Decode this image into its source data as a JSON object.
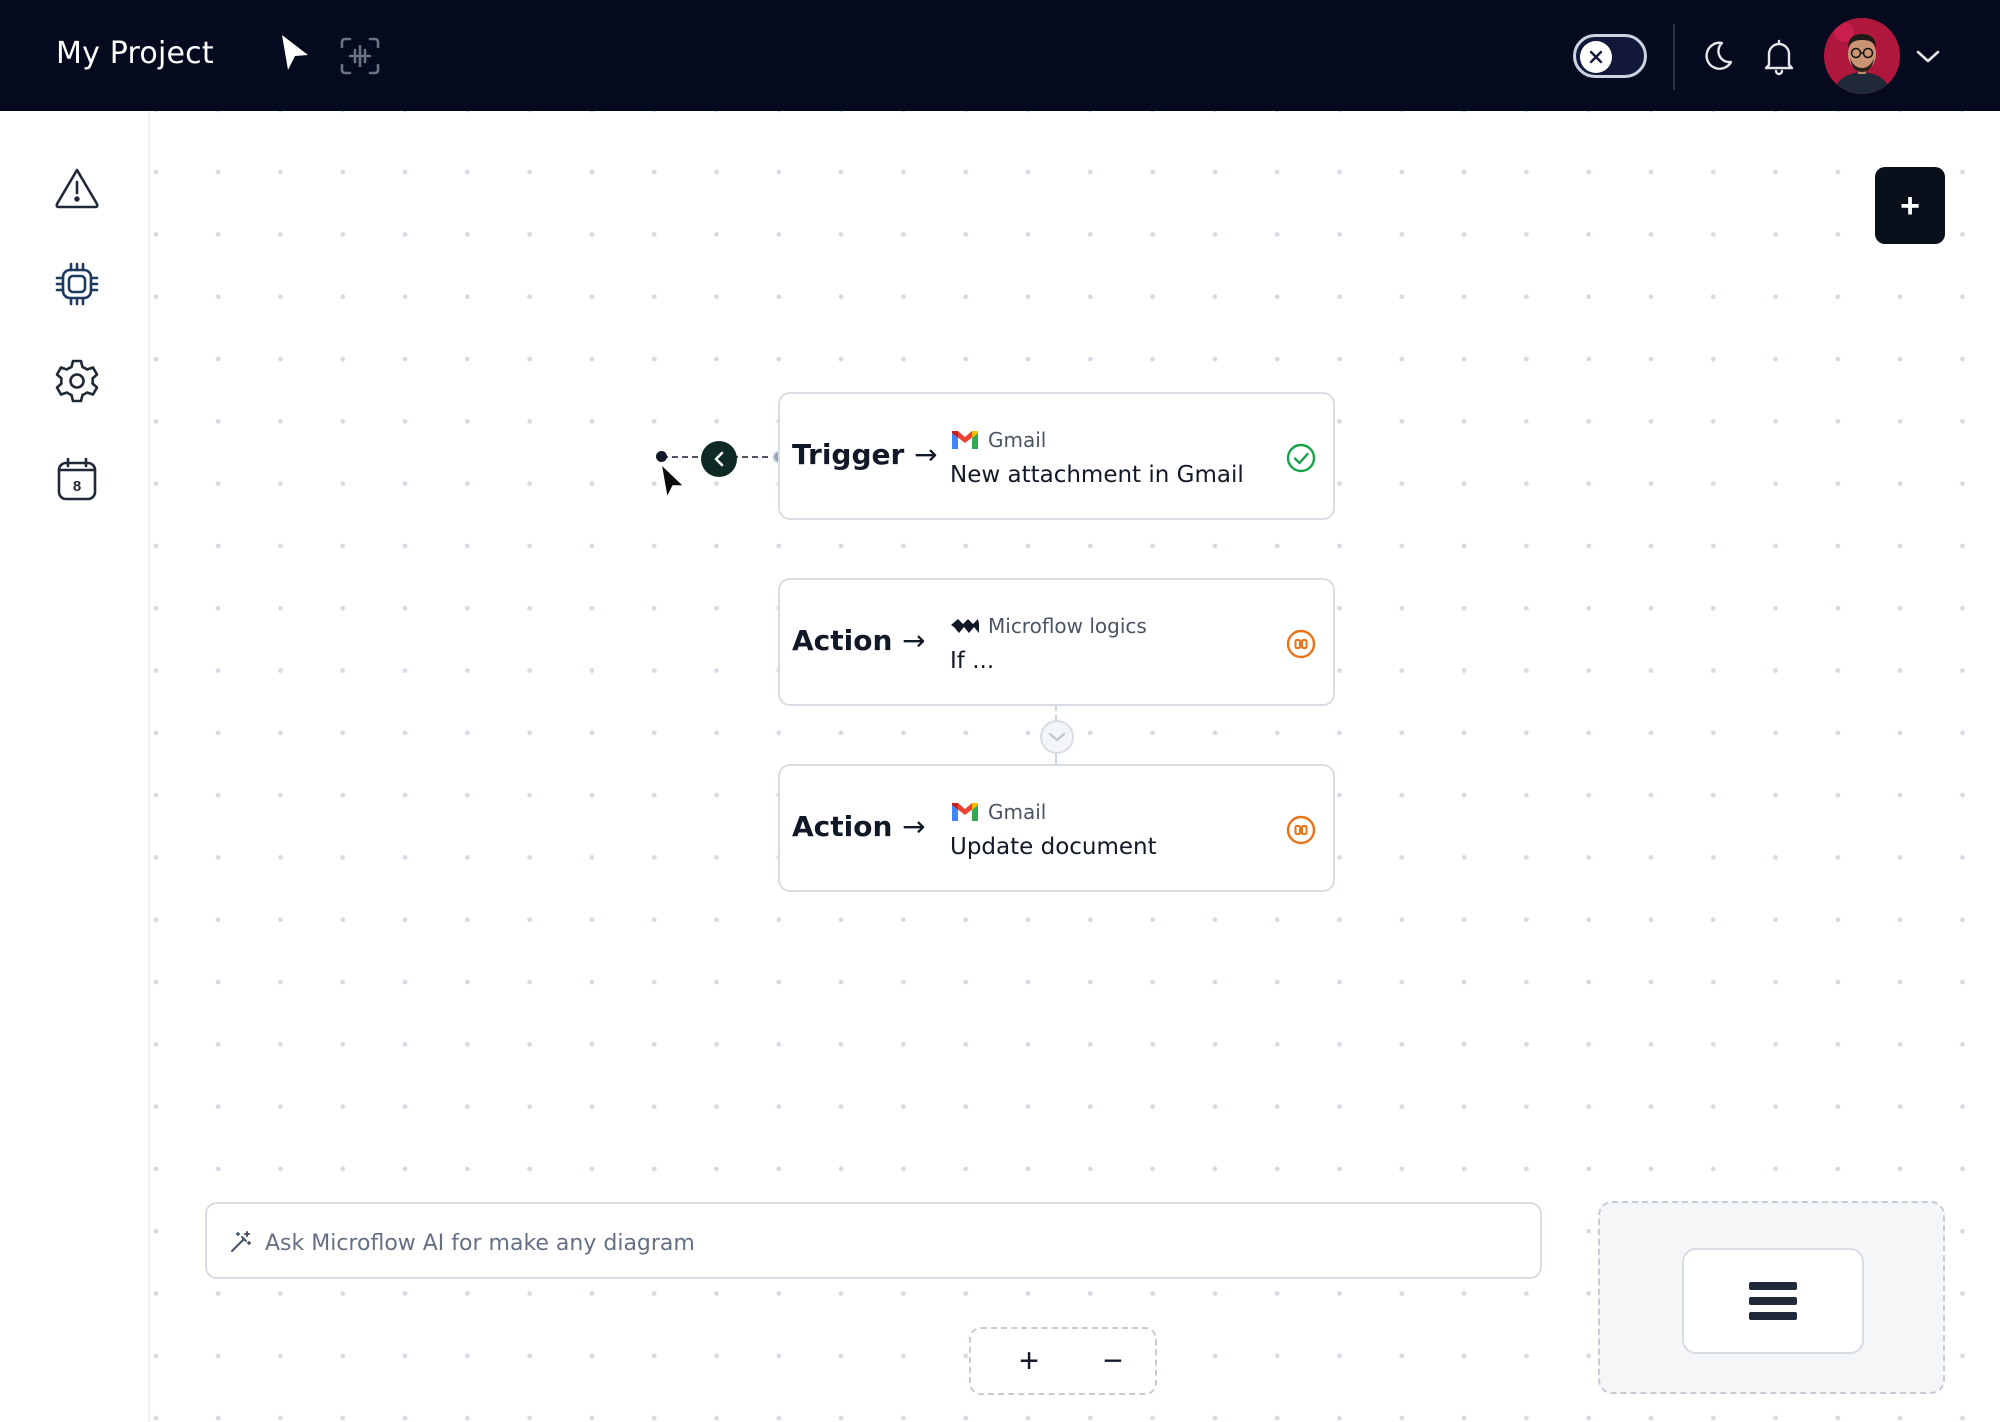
{
  "header": {
    "project_title": "My Project",
    "tools": [
      "pointer-tool",
      "frame-tool"
    ],
    "toggle_state": "off",
    "icons": [
      "moon-icon",
      "bell-icon",
      "chevron-down-icon"
    ]
  },
  "sidebar": {
    "items": [
      {
        "icon": "warning-icon"
      },
      {
        "icon": "chip-icon"
      },
      {
        "icon": "gear-icon"
      },
      {
        "icon": "calendar-icon",
        "badge": "8"
      }
    ]
  },
  "canvas": {
    "add_button_label": "+",
    "nodes": [
      {
        "kind": "Trigger",
        "arrow": "→",
        "app": "Gmail",
        "title": "New attachment in Gmail",
        "status": "success"
      },
      {
        "kind": "Action",
        "arrow": "→",
        "app": "Microflow logics",
        "title": "If ...",
        "status": "paused"
      },
      {
        "kind": "Action",
        "arrow": "→",
        "app": "Gmail",
        "title": "Update document",
        "status": "paused"
      }
    ]
  },
  "ai_prompt": {
    "placeholder": "Ask Microflow AI for make any diagram",
    "value": ""
  },
  "zoom": {
    "in_label": "+",
    "out_label": "−"
  },
  "colors": {
    "topbar": "#050a1e",
    "success": "#16a34a",
    "paused": "#ea7317",
    "accent_dark": "#0a0f1c"
  }
}
